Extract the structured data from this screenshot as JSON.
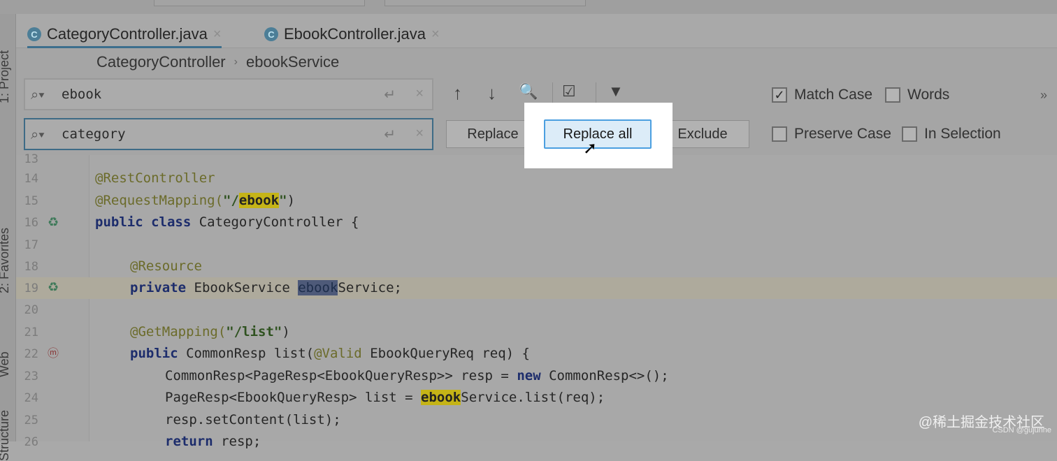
{
  "tool_windows": {
    "project": "1: Project",
    "favorites": "2: Favorites",
    "web": "Web",
    "structure": "Structure"
  },
  "tabs": [
    {
      "label": "CategoryController.java",
      "icon": "C",
      "close": "×"
    },
    {
      "label": "EbookController.java",
      "icon": "C",
      "close": "×"
    }
  ],
  "breadcrumb": {
    "item1": "CategoryController",
    "item2": "ebookService",
    "sep": "›"
  },
  "find": {
    "search_value": "ebook",
    "replace_value": "category"
  },
  "toolbar": {
    "up": "↑",
    "down": "↓",
    "find_all": "🔍",
    "select": "☑",
    "filter": "▼"
  },
  "buttons": {
    "replace": "Replace",
    "replace_all": "Replace all",
    "exclude": "Exclude"
  },
  "options": {
    "match_case": {
      "label": "Match Case",
      "checked": true
    },
    "words": {
      "label": "Words",
      "checked": false
    },
    "preserve_case": {
      "label": "Preserve Case",
      "checked": false
    },
    "in_selection": {
      "label": "In Selection",
      "checked": false
    },
    "more": "»"
  },
  "code_lines": {
    "n13": "13",
    "n14": "14",
    "n15": "15",
    "n16": "16",
    "n17": "17",
    "n18": "18",
    "n19": "19",
    "n20": "20",
    "n21": "21",
    "n22": "22",
    "n23": "23",
    "n24": "24",
    "n25": "25",
    "n26": "26"
  },
  "code": {
    "l14": "@RestController",
    "l15a": "@RequestMapping(",
    "l15b": "\"/",
    "l15c": "ebook",
    "l15d": "\"",
    "l15e": ")",
    "l16a": "public class",
    "l16b": " CategoryController {",
    "l18": "@Resource",
    "l19a": "private",
    "l19b": " EbookService ",
    "l19c": "ebook",
    "l19d": "Service;",
    "l21a": "@GetMapping(",
    "l21b": "\"/list\"",
    "l21c": ")",
    "l22a": "public",
    "l22b": " CommonResp list(",
    "l22c": "@Valid",
    "l22d": " EbookQueryReq req) {",
    "l23a": "CommonResp<PageResp<EbookQueryResp>> resp = ",
    "l23b": "new",
    "l23c": " CommonResp<>();",
    "l24a": "PageResp<EbookQueryResp> list = ",
    "l24b": "ebook",
    "l24c": "Service.list(req);",
    "l25": "resp.setContent(list);",
    "l26a": "return",
    "l26b": " resp;"
  },
  "watermark": {
    "main": "@稀土掘金技术社区",
    "sub": "CSDN @gujunhe"
  }
}
